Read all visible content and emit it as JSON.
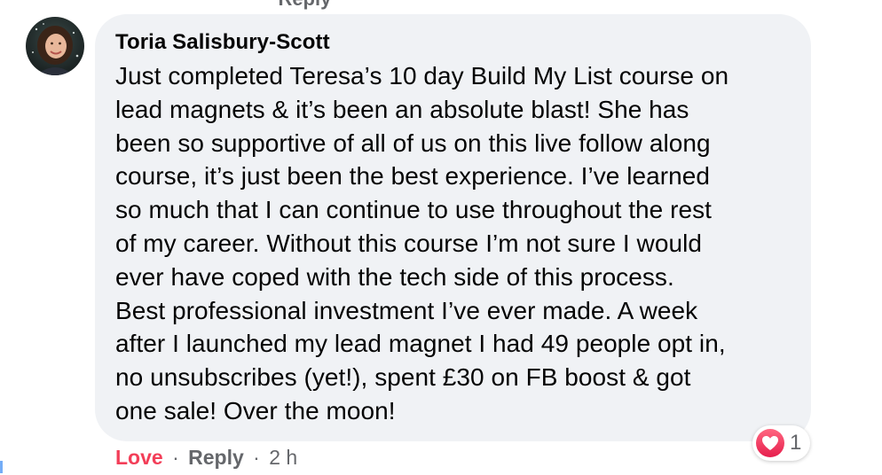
{
  "comment": {
    "author": "Toria Salisbury-Scott",
    "text": "Just completed Teresa’s 10 day Build My List course on\nlead magnets & it’s been an absolute blast! She has\nbeen so supportive of all of us on this live follow along\ncourse, it’s just been the best experience. I’ve learned\nso much that I can continue to use throughout the rest\nof my career. Without this course I’m not sure I would\never have coped with the tech side of this process.\nBest professional investment I’ve ever made. A week\nafter I launched my lead magnet I had 49 people opt in,\nno unsubscribes (yet!), spent £30 on FB boost & got\none sale! Over the moon!"
  },
  "actions": {
    "love_label": "Love",
    "separator": "·",
    "reply_label": "Reply",
    "timestamp": "2 h"
  },
  "reactions": {
    "icon": "heart-icon",
    "count": "1"
  },
  "colors": {
    "bubble_bg": "#f0f2f5",
    "love_active": "#f33e58",
    "meta_text": "#65676b"
  }
}
